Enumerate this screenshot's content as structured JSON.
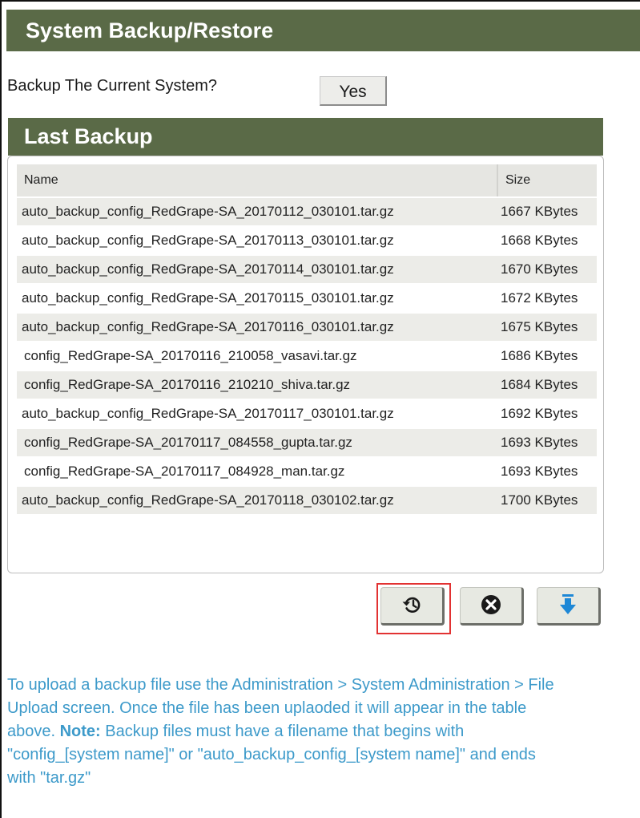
{
  "title": "System Backup/Restore",
  "backup": {
    "question": "Backup The Current System?",
    "yes_label": "Yes"
  },
  "last_backup": {
    "heading": "Last Backup",
    "columns": {
      "name": "Name",
      "size": "Size"
    },
    "rows": [
      {
        "name": "auto_backup_config_RedGrape-SA_20170112_030101.tar.gz",
        "size": "1667 KBytes"
      },
      {
        "name": "auto_backup_config_RedGrape-SA_20170113_030101.tar.gz",
        "size": "1668 KBytes"
      },
      {
        "name": "auto_backup_config_RedGrape-SA_20170114_030101.tar.gz",
        "size": "1670 KBytes"
      },
      {
        "name": "auto_backup_config_RedGrape-SA_20170115_030101.tar.gz",
        "size": "1672 KBytes"
      },
      {
        "name": "auto_backup_config_RedGrape-SA_20170116_030101.tar.gz",
        "size": "1675 KBytes"
      },
      {
        "name": "config_RedGrape-SA_20170116_210058_vasavi.tar.gz",
        "size": "1686 KBytes"
      },
      {
        "name": "config_RedGrape-SA_20170116_210210_shiva.tar.gz",
        "size": "1684 KBytes"
      },
      {
        "name": "auto_backup_config_RedGrape-SA_20170117_030101.tar.gz",
        "size": "1692 KBytes"
      },
      {
        "name": "config_RedGrape-SA_20170117_084558_gupta.tar.gz",
        "size": "1693 KBytes"
      },
      {
        "name": "config_RedGrape-SA_20170117_084928_man.tar.gz",
        "size": "1693 KBytes"
      },
      {
        "name": "auto_backup_config_RedGrape-SA_20170118_030102.tar.gz",
        "size": "1700 KBytes"
      }
    ]
  },
  "actions": [
    {
      "name": "restore-button",
      "icon": "restore-icon",
      "highlighted": true
    },
    {
      "name": "delete-button",
      "icon": "delete-icon"
    },
    {
      "name": "download-button",
      "icon": "download-icon"
    }
  ],
  "help": {
    "text_before": "To upload a backup file use the Administration > System Administration > File Upload screen. Once the file has been uplaoded it will appear in the table above. ",
    "note_label": "Note:",
    "text_after": " Backup files must have a filename that begins with \"config_[system name]\" or \"auto_backup_config_[system name]\" and ends with \"tar.gz\""
  },
  "colors": {
    "header_green": "#5a6a47",
    "help_blue": "#3d9aca",
    "highlight_red": "#e23232",
    "download_blue": "#1e88d6"
  }
}
